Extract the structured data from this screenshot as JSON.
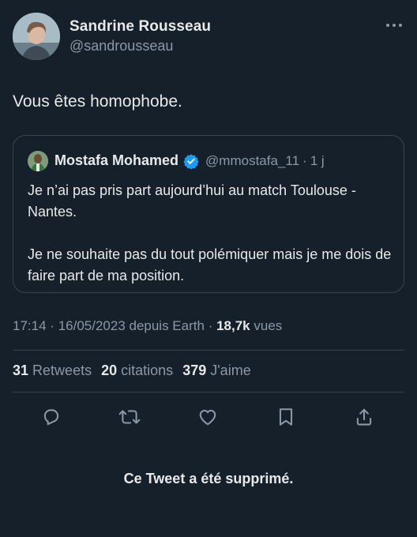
{
  "tweet": {
    "author": {
      "name": "Sandrine Rousseau",
      "handle": "@sandrousseau"
    },
    "text": "Vous êtes homophobe.",
    "quoted": {
      "author_name": "Mostafa Mohamed",
      "verified": true,
      "handle": "@mmostafa_11",
      "separator": "·",
      "time": "1 j",
      "paragraphs": [
        "Je n’ai pas pris part aujourd’hui au match Toulouse - Nantes.",
        "Je ne souhaite pas du tout polémiquer mais je me dois de faire part de ma position."
      ]
    },
    "meta": {
      "time": "17:14",
      "separator": "·",
      "date_source": "16/05/2023 depuis Earth",
      "views_count": "18,7k",
      "views_label": "vues"
    },
    "stats": [
      {
        "count": "31",
        "label": "Retweets"
      },
      {
        "count": "20",
        "label": "citations"
      },
      {
        "count": "379",
        "label": "J'aime"
      }
    ],
    "actions": [
      {
        "icon": "reply-icon"
      },
      {
        "icon": "retweet-icon"
      },
      {
        "icon": "like-icon"
      },
      {
        "icon": "bookmark-icon"
      },
      {
        "icon": "share-icon"
      }
    ],
    "deleted_notice": "Ce Tweet a été supprimé."
  },
  "colors": {
    "background": "#15202b",
    "text": "#e7e9ea",
    "secondary": "#8b98a5",
    "border": "#38444d",
    "verified": "#1d9bf0"
  }
}
